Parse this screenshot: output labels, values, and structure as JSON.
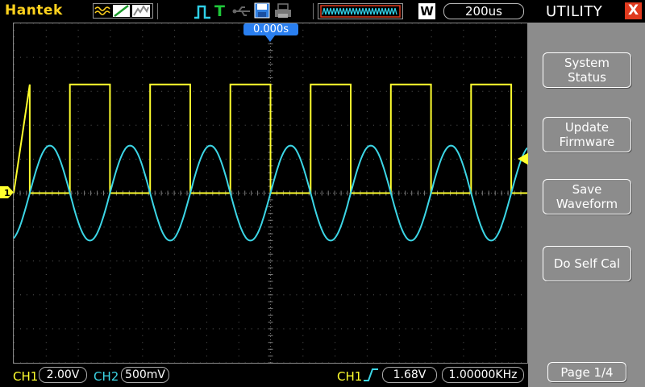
{
  "header": {
    "brand": "Hantek",
    "mode_letter": "W",
    "timebase": "200us",
    "trigger_position": "0.000s"
  },
  "icons": {
    "waveform_mode": "waveform-modes-icon",
    "trigger_edge": "trigger-edge-icon",
    "trigger_status": "T",
    "usb": "usb-icon",
    "save": "save-icon",
    "print": "print-icon",
    "memory": "memory-depth-icon"
  },
  "footer": {
    "ch1_label": "CH1",
    "ch1_scale": "2.00V",
    "ch2_label": "CH2",
    "ch2_scale": "500mV",
    "trig_source": "CH1",
    "trig_level": "1.68V",
    "frequency": "1.00000KHz"
  },
  "panel": {
    "title": "UTILITY",
    "close": "X",
    "buttons": [
      {
        "label": "System\nStatus"
      },
      {
        "label": "Update\nFirmware"
      },
      {
        "label": "Save\nWaveform"
      },
      {
        "label": "Do Self Cal"
      }
    ],
    "page": "Page 1/4"
  },
  "colors": {
    "ch1": "#ffff2e",
    "ch2": "#3cd6e6",
    "accent": "#2a7ff0",
    "panel": "#8c8c8c"
  },
  "chart_data": {
    "type": "line",
    "series": [
      {
        "channel": "CH1",
        "shape": "square",
        "period_div": 2.5,
        "high_div": 3.2,
        "low_div": 0,
        "phase_div": 0
      },
      {
        "channel": "CH2",
        "shape": "sine",
        "period_div": 2.5,
        "amplitude_div": 1.4,
        "offset_div": 0,
        "phase_div": 0
      }
    ],
    "xlim": [
      -8,
      8
    ],
    "ylim": [
      -5,
      5
    ],
    "grid": true
  }
}
